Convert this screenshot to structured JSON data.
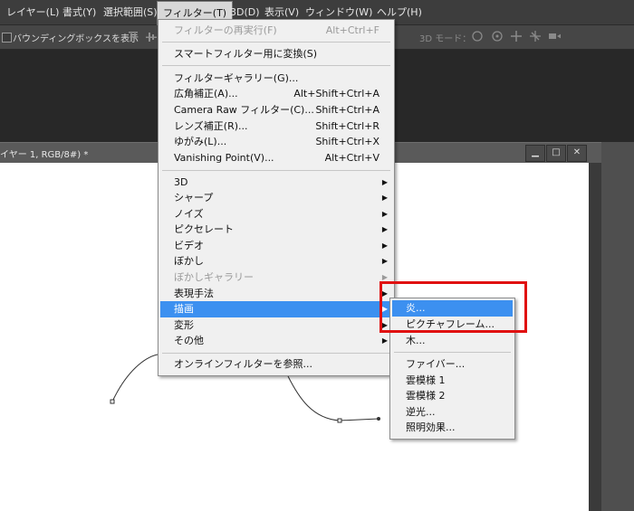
{
  "menubar": {
    "items": [
      {
        "label": "レイヤー(L)"
      },
      {
        "label": "書式(Y)"
      },
      {
        "label": "選択範囲(S)"
      },
      {
        "label": "フィルター(T)"
      },
      {
        "label": "3D(D)"
      },
      {
        "label": "表示(V)"
      },
      {
        "label": "ウィンドウ(W)"
      },
      {
        "label": "ヘルプ(H)"
      }
    ]
  },
  "options_bar": {
    "bounding_box_label": "バウンディングボックスを表示",
    "mode_3d_label": "3D モード："
  },
  "document": {
    "tab_title": "イヤー 1, RGB/8#) *",
    "win_min": "▁",
    "win_restore": "□",
    "win_close": "✕"
  },
  "filter_menu": {
    "items": [
      {
        "label": "フィルターの再実行(F)",
        "shortcut": "Alt+Ctrl+F",
        "disabled": true
      },
      {
        "label": "スマートフィルター用に変換(S)",
        "shortcut": ""
      },
      {
        "label": "フィルターギャラリー(G)...",
        "shortcut": ""
      },
      {
        "label": "広角補正(A)...",
        "shortcut": "Alt+Shift+Ctrl+A"
      },
      {
        "label": "Camera Raw フィルター(C)...",
        "shortcut": "Shift+Ctrl+A"
      },
      {
        "label": "レンズ補正(R)...",
        "shortcut": "Shift+Ctrl+R"
      },
      {
        "label": "ゆがみ(L)...",
        "shortcut": "Shift+Ctrl+X"
      },
      {
        "label": "Vanishing Point(V)...",
        "shortcut": "Alt+Ctrl+V"
      },
      {
        "label": "3D",
        "submenu": true
      },
      {
        "label": "シャープ",
        "submenu": true
      },
      {
        "label": "ノイズ",
        "submenu": true
      },
      {
        "label": "ピクセレート",
        "submenu": true
      },
      {
        "label": "ビデオ",
        "submenu": true
      },
      {
        "label": "ぼかし",
        "submenu": true
      },
      {
        "label": "ぼかしギャラリー",
        "submenu": true,
        "disabled": true
      },
      {
        "label": "表現手法",
        "submenu": true
      },
      {
        "label": "描画",
        "submenu": true,
        "highlighted": true
      },
      {
        "label": "変形",
        "submenu": true
      },
      {
        "label": "その他",
        "submenu": true
      },
      {
        "label": "オンラインフィルターを参照...",
        "shortcut": ""
      }
    ],
    "arrow_glyph": "▶"
  },
  "render_submenu": {
    "items": [
      {
        "label": "炎...",
        "highlighted": true
      },
      {
        "label": "ピクチャフレーム..."
      },
      {
        "label": "木..."
      },
      {
        "label": "ファイバー..."
      },
      {
        "label": "雲模様 1"
      },
      {
        "label": "雲模様 2"
      },
      {
        "label": "逆光..."
      },
      {
        "label": "照明効果..."
      }
    ]
  },
  "colors": {
    "highlight": "#3c90f0",
    "annotation_box": "#e01010"
  }
}
